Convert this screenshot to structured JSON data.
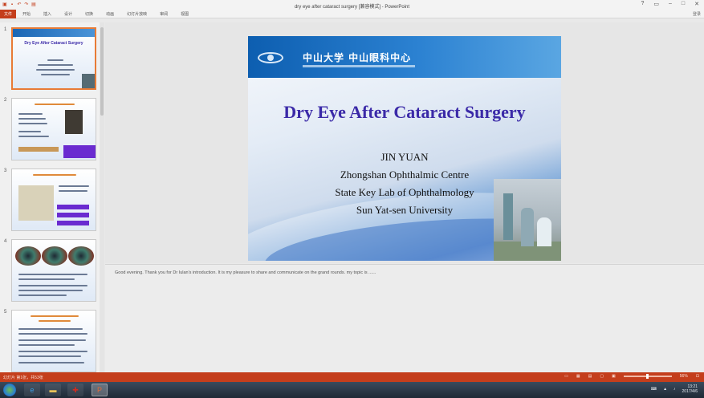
{
  "window": {
    "title": "dry eye after cataract surgery [兼容模式] - PowerPoint",
    "minimize_icon": "minimize-icon",
    "maximize_icon": "maximize-icon",
    "close_icon": "close-icon"
  },
  "ribbon": {
    "file_tab": "文件",
    "tabs": [
      "开始",
      "插入",
      "设计",
      "切换",
      "动画",
      "幻灯片放映",
      "审阅",
      "视图"
    ],
    "user": "登录"
  },
  "thumbnails": [
    {
      "number": "1",
      "title": "Dry Eye After Cataract Surgery"
    },
    {
      "number": "2",
      "title": ""
    },
    {
      "number": "3",
      "title": ""
    },
    {
      "number": "4",
      "title": ""
    },
    {
      "number": "5",
      "title": ""
    }
  ],
  "slide": {
    "logo_text": "中山大学  中山眼科中心",
    "title": "Dry Eye After Cataract Surgery",
    "author_lines": [
      "JIN YUAN",
      "Zhongshan Ophthalmic Centre",
      "State Key Lab of Ophthalmology",
      "Sun Yat-sen University"
    ]
  },
  "notes": {
    "text": "Good evening. Thank you for Dr Iulan's introduction. It is my pleasure to share and communicate on the grand rounds. my topic is ......"
  },
  "status": {
    "left": "幻灯片 第1张，共53张",
    "zoom": "56%",
    "zoom_fraction": 0.5
  },
  "taskbar": {
    "apps": [
      "ie-icon",
      "folder-icon",
      "pdf-icon",
      "powerpoint-icon"
    ],
    "time": "13:21",
    "date": "2017/4/6"
  },
  "colors": {
    "accent": "#c43e1c",
    "slide_title": "#3b2aa8",
    "header_blue": "#0d5eb0"
  }
}
